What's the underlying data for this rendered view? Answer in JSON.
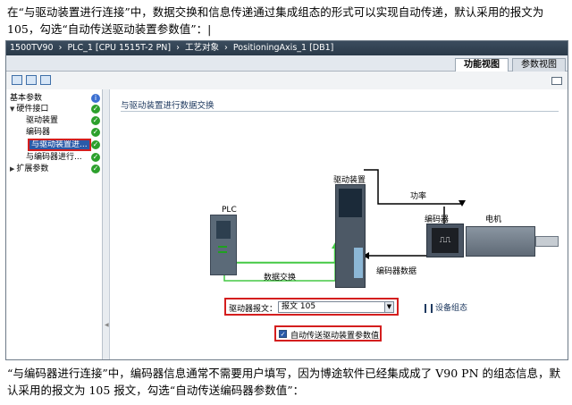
{
  "doc": {
    "para_top": "在“与驱动装置进行连接”中，数据交换和信息传递通过集成组态的形式可以实现自动传递，默认采用的报文为 105，勾选“自动传送驱动装置参数值”：|",
    "para_bottom": "“与编码器进行连接”中，编码器信息通常不需要用户填写，因为博途软件已经集成成了 V90 PN 的组态信息，默认采用的报文为 105 报文，勾选“自动传送编码器参数值”："
  },
  "titlebar": {
    "crumbs": [
      "1500TV90",
      "›",
      "PLC_1 [CPU 1515T-2 PN]",
      "›",
      "工艺对象",
      "›",
      "PositioningAxis_1 [DB1]"
    ]
  },
  "view_tabs": {
    "function_view": "功能视图",
    "parameter_view": "参数视图"
  },
  "nav": {
    "items": [
      {
        "label": "基本参数",
        "status": "blue"
      },
      {
        "label": "硬件接口",
        "status": "green",
        "expanded": true
      },
      {
        "label": "驱动装置",
        "status": "green"
      },
      {
        "label": "编码器",
        "status": "green"
      },
      {
        "label": "与驱动装置进...",
        "status": "green",
        "selected": true
      },
      {
        "label": "与编码器进行...",
        "status": "green"
      },
      {
        "label": "扩展参数",
        "status": "green",
        "collapsed": true
      }
    ]
  },
  "content": {
    "section_title": "与驱动装置进行数据交换",
    "plc_label": "PLC",
    "drive_label": "驱动装置",
    "power_label": "功率",
    "encoder_label": "编码器",
    "motor_label": "电机",
    "data_exchange_label": "数据交换",
    "encoder_data_label": "编码器数据",
    "encoder_symbol": "⎍⎍",
    "drive_telegram_label": "驱动器报文：",
    "drive_telegram_value": "报文 105",
    "device_config_label": "设备组态",
    "auto_transfer_label": "自动传送驱动装置参数值",
    "auto_transfer_checked": true
  },
  "colors": {
    "accent_red": "#d41e1e",
    "ok_green": "#2ca02c",
    "info_blue": "#3b6fd1",
    "data_line": "#44c944"
  }
}
